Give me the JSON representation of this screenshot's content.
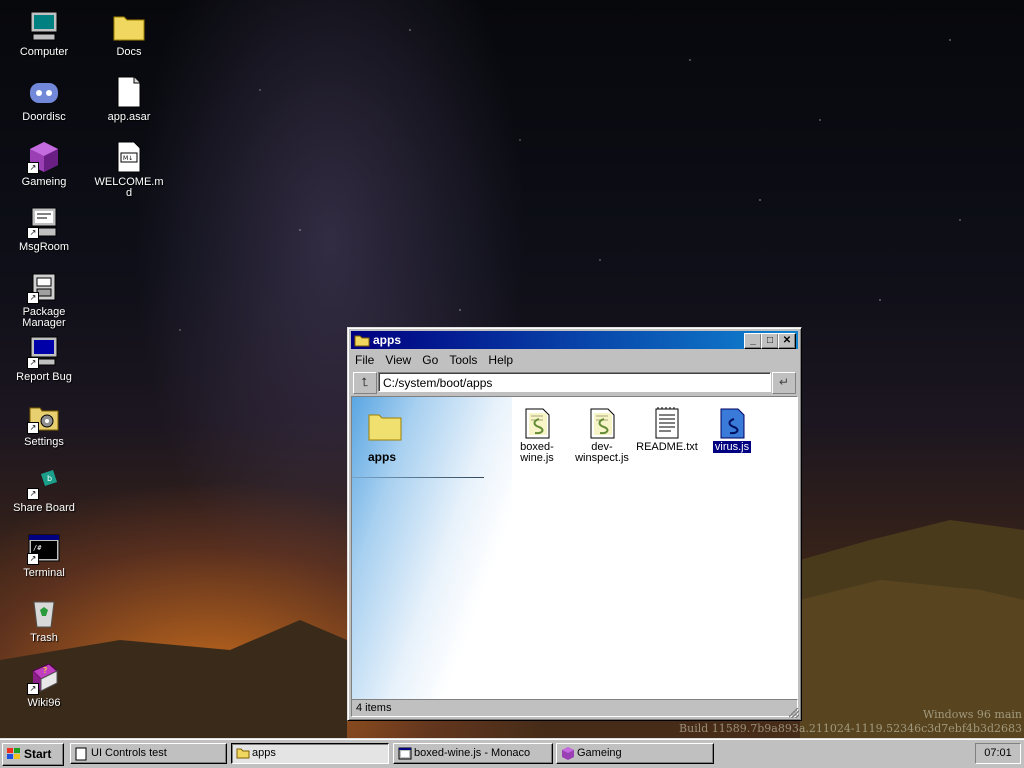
{
  "desktop": {
    "icons": [
      {
        "label": "Computer",
        "icon": "computer-icon"
      },
      {
        "label": "Docs",
        "icon": "folder-icon"
      },
      {
        "label": "Doordisc",
        "icon": "discord-icon"
      },
      {
        "label": "app.asar",
        "icon": "file-icon"
      },
      {
        "label": "Gameing",
        "icon": "cube-icon"
      },
      {
        "label": "WELCOME.md",
        "icon": "markdown-icon"
      },
      {
        "label": "MsgRoom",
        "icon": "chat-icon"
      },
      {
        "label": "Package Manager",
        "icon": "package-icon"
      },
      {
        "label": "Report Bug",
        "icon": "bug-report-icon"
      },
      {
        "label": "Settings",
        "icon": "settings-icon"
      },
      {
        "label": "Share Board",
        "icon": "share-icon"
      },
      {
        "label": "Terminal",
        "icon": "terminal-icon"
      },
      {
        "label": "Trash",
        "icon": "trash-icon"
      },
      {
        "label": "Wiki96",
        "icon": "book-icon"
      }
    ]
  },
  "window": {
    "title": "apps",
    "menu": [
      "File",
      "View",
      "Go",
      "Tools",
      "Help"
    ],
    "address": "C:/system/boot/apps",
    "folder_title": "apps",
    "files": [
      {
        "label": "boxed-wine.js",
        "icon": "script-icon",
        "selected": false
      },
      {
        "label": "dev-winspect.js",
        "icon": "script-icon",
        "selected": false
      },
      {
        "label": "README.txt",
        "icon": "text-file-icon",
        "selected": false
      },
      {
        "label": "virus.js",
        "icon": "script-icon",
        "selected": true
      }
    ],
    "status": "4 items"
  },
  "build": {
    "line1": "Windows 96 main",
    "line2": "Build 11589.7b9a893a.211024-1119.52346c3d7ebf4b3d2683"
  },
  "taskbar": {
    "start": "Start",
    "tasks": [
      {
        "label": "UI Controls test",
        "active": false
      },
      {
        "label": "apps",
        "active": true
      },
      {
        "label": "boxed-wine.js - Monaco",
        "active": false
      },
      {
        "label": "Gameing",
        "active": false
      }
    ],
    "clock": "07:01"
  },
  "colors": {
    "titlebar_start": "#000080",
    "titlebar_end": "#1084d0",
    "selection": "#000080",
    "chrome": "#c0c0c0"
  }
}
